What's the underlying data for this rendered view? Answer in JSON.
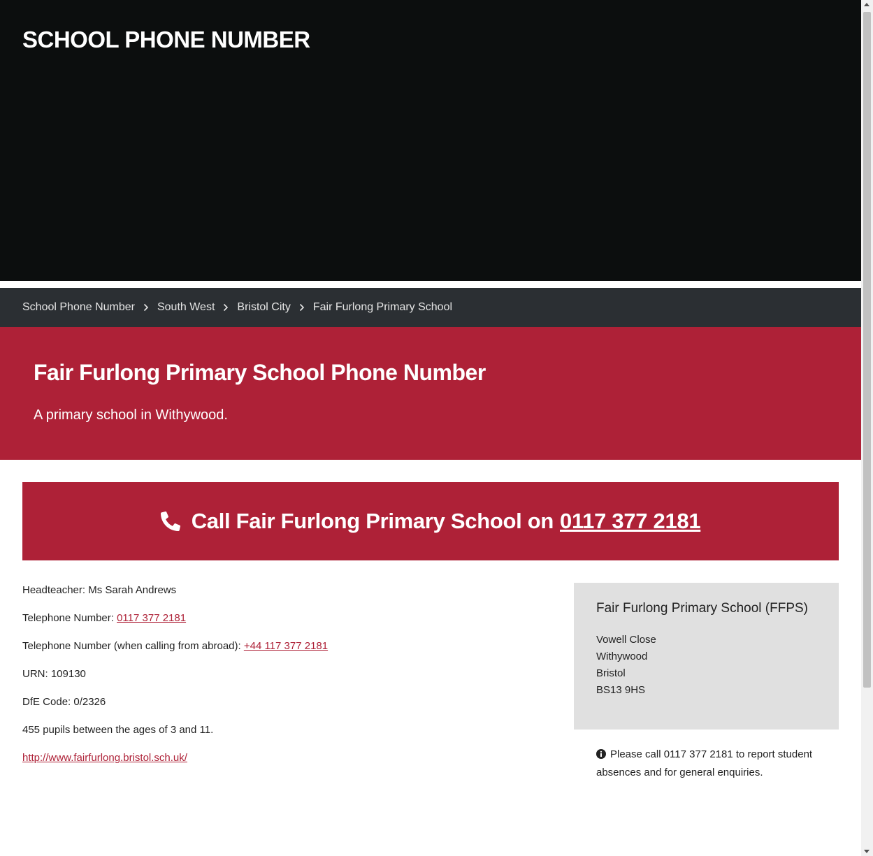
{
  "header": {
    "site_title": "SCHOOL PHONE NUMBER"
  },
  "breadcrumb": {
    "items": [
      {
        "label": "School Phone Number"
      },
      {
        "label": "South West"
      },
      {
        "label": "Bristol City"
      },
      {
        "label": "Fair Furlong Primary School"
      }
    ],
    "separator_icon": "chevron-right-icon"
  },
  "hero": {
    "title": "Fair Furlong Primary School Phone Number",
    "subtitle": "A primary school in Withywood."
  },
  "call_box": {
    "icon": "phone-icon",
    "prefix": "Call Fair Furlong Primary School on",
    "phone": "0117 377 2181"
  },
  "details": {
    "headteacher": "Headteacher: Ms Sarah Andrews",
    "telephone_label": "Telephone Number: ",
    "telephone_value": "0117 377 2181",
    "abroad_label": "Telephone Number (when calling from abroad): ",
    "abroad_value": "+44 117 377 2181",
    "urn": "URN: 109130",
    "dfe_code": "DfE Code: 0/2326",
    "pupils": "455 pupils between the ages of 3 and 11.",
    "website": "http://www.fairfurlong.bristol.sch.uk/"
  },
  "address": {
    "name": "Fair Furlong Primary School (FFPS)",
    "lines": [
      "Vowell Close",
      "Withywood",
      "Bristol",
      "BS13 9HS"
    ]
  },
  "notice": {
    "icon": "info-icon",
    "text": "Please call 0117 377 2181 to report student absences and for general enquiries."
  },
  "colors": {
    "header_bg": "#0c0e0e",
    "breadcrumb_bg": "#2b2f33",
    "accent": "#ae2137",
    "card_bg": "#e0e0e0"
  }
}
